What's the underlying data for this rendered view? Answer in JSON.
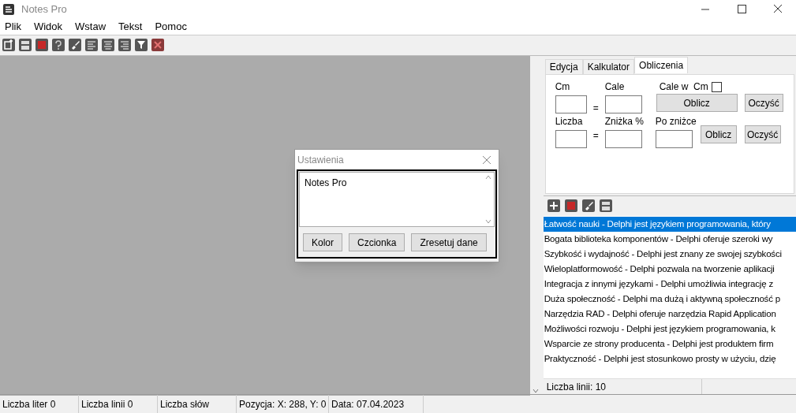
{
  "window": {
    "title": "Notes Pro"
  },
  "menu": [
    "Plik",
    "Widok",
    "Wstaw",
    "Tekst",
    "Pomoc"
  ],
  "toolbar": [
    {
      "kind": "new"
    },
    {
      "kind": "save"
    },
    {
      "kind": "delete"
    },
    {
      "kind": "help"
    },
    {
      "kind": "brush"
    },
    {
      "kind": "align-left"
    },
    {
      "kind": "align-center"
    },
    {
      "kind": "align-right"
    },
    {
      "kind": "filter"
    },
    {
      "kind": "delete-x"
    }
  ],
  "tabs": [
    {
      "label": "Edycja",
      "selected": false
    },
    {
      "label": "Kalkulator",
      "selected": false
    },
    {
      "label": "Obliczenia",
      "selected": true
    }
  ],
  "converter": {
    "cm_label": "Cm",
    "equals": "=",
    "inch_label": "Cale",
    "toggle_label": "Cale w  Cm",
    "toggle_checked": false,
    "calc_button": "Oblicz",
    "clear_button": "Oczyść"
  },
  "discount": {
    "number_label": "Liczba",
    "equals": "=",
    "discount_label": "Zniżka %",
    "result_label": "Po zniżce",
    "calc_button": "Oblicz",
    "clear_button": "Oczyść"
  },
  "list_toolbar": [
    {
      "kind": "add"
    },
    {
      "kind": "delete"
    },
    {
      "kind": "brush"
    },
    {
      "kind": "save"
    }
  ],
  "list": [
    {
      "text": "Łatwość nauki - Delphi jest językiem programowania, który",
      "selected": true
    },
    {
      "text": "Bogata biblioteka komponentów - Delphi oferuje szeroki wy",
      "selected": false
    },
    {
      "text": "Szybkość i wydajność - Delphi jest znany ze swojej szybkości",
      "selected": false
    },
    {
      "text": "Wieloplatformowość - Delphi pozwala na tworzenie aplikacji",
      "selected": false
    },
    {
      "text": "Integracja z innymi językami - Delphi umożliwia integrację z",
      "selected": false
    },
    {
      "text": "Duża społeczność - Delphi ma dużą i aktywną społeczność p",
      "selected": false
    },
    {
      "text": "Narzędzia RAD - Delphi oferuje narzędzia Rapid Application",
      "selected": false
    },
    {
      "text": "Możliwości rozwoju - Delphi jest językiem programowania, k",
      "selected": false
    },
    {
      "text": "Wsparcie ze strony producenta - Delphi jest produktem firm",
      "selected": false
    },
    {
      "text": "Praktyczność - Delphi jest stosunkowo prosty w użyciu, dzię",
      "selected": false
    }
  ],
  "list_status": "Liczba linii: 10",
  "dialog": {
    "title": "Ustawienia",
    "text": "Notes Pro",
    "buttons": [
      "Kolor",
      "Czcionka",
      "Zresetuj dane"
    ]
  },
  "status_bar": [
    "Liczba liter 0",
    "Liczba linii 0",
    "Liczba słów",
    "Pozycja: X: 288, Y: 0",
    "Data: 07.04.2023"
  ]
}
